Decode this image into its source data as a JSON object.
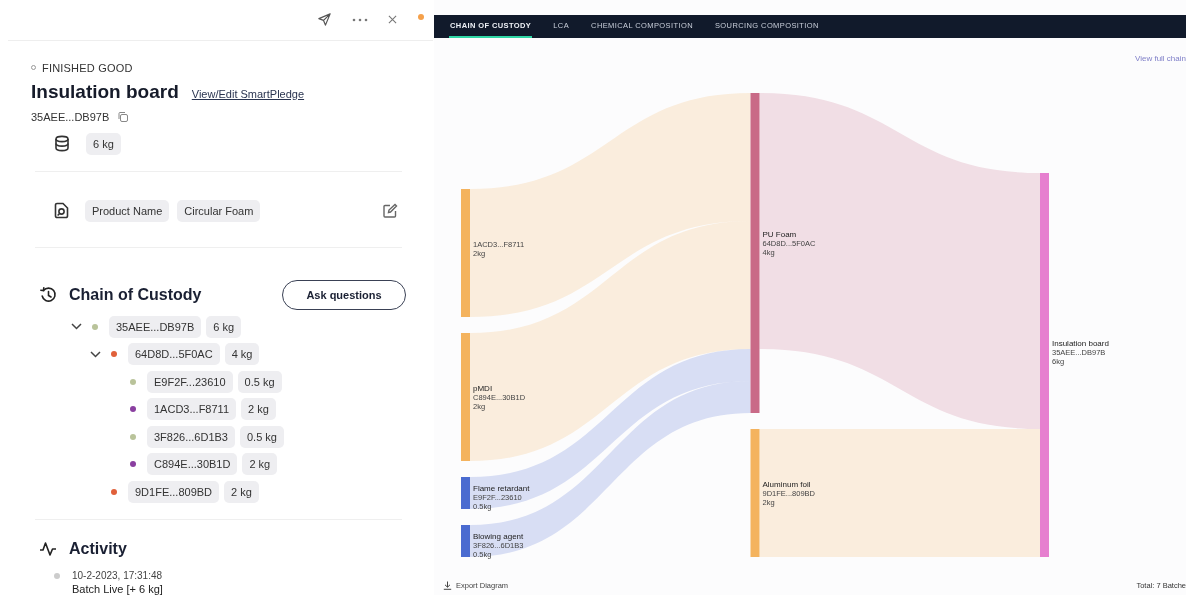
{
  "product": {
    "category": "FINISHED GOOD",
    "title": "Insulation board",
    "edit_link": "View/Edit SmartPledge",
    "id": "35AEE...DB97B",
    "weight": "6 kg",
    "fields": [
      "Product Name",
      "Circular Foam"
    ]
  },
  "chain_of_custody": {
    "title": "Chain of Custody",
    "button": "Ask questions",
    "tree": [
      {
        "id": "35AEE...DB97B",
        "weight": "6 kg",
        "color": "#b9c39a",
        "expanded": true,
        "children": [
          {
            "id": "64D8D...5F0AC",
            "weight": "4 kg",
            "color": "#e0603a",
            "expanded": true,
            "children": [
              {
                "id": "E9F2F...23610",
                "weight": "0.5 kg",
                "color": "#b9c39a"
              },
              {
                "id": "1ACD3...F8711",
                "weight": "2 kg",
                "color": "#8a3fa0"
              },
              {
                "id": "3F826...6D1B3",
                "weight": "0.5 kg",
                "color": "#b9c39a"
              },
              {
                "id": "C894E...30B1D",
                "weight": "2 kg",
                "color": "#8a3fa0"
              }
            ]
          },
          {
            "id": "9D1FE...809BD",
            "weight": "2 kg",
            "color": "#e0603a"
          }
        ]
      }
    ]
  },
  "activity": {
    "title": "Activity",
    "events": [
      {
        "time": "10-2-2023, 17:31:48",
        "text": "Batch Live [+ 6 kg]"
      }
    ]
  },
  "diagram": {
    "tabs": [
      {
        "label": "CHAIN OF CUSTODY",
        "selected": true
      },
      {
        "label": "LCA",
        "selected": false
      },
      {
        "label": "CHEMICAL COMPOSITION",
        "selected": false
      },
      {
        "label": "SOURCING COMPOSITION",
        "selected": false
      }
    ],
    "view_link": "View full chain",
    "nodes": [
      {
        "id": "1ACD3...F8711",
        "weight": "2kg",
        "color": "#f4b35e"
      },
      {
        "name": "pMDI",
        "id": "C894E...30B1D",
        "weight": "2kg",
        "color": "#f4b35e"
      },
      {
        "name": "Flame retardant",
        "id": "E9F2F...23610",
        "weight": "0.5kg",
        "color": "#4a6bd0"
      },
      {
        "name": "Blowing agent",
        "id": "3F826...6D1B3",
        "weight": "0.5kg",
        "color": "#4a6bd0"
      },
      {
        "name": "PU Foam",
        "id": "64D8D...5F0AC",
        "weight": "4kg",
        "color": "#c96a87"
      },
      {
        "name": "Aluminum foil",
        "id": "9D1FE...809BD",
        "weight": "2kg",
        "color": "#f4b35e"
      },
      {
        "name": "Insulation board",
        "id": "35AEE...DB97B",
        "weight": "6kg",
        "color": "#e67fcf"
      }
    ],
    "export": "Export Diagram",
    "total": "Total: 7 Batche"
  }
}
